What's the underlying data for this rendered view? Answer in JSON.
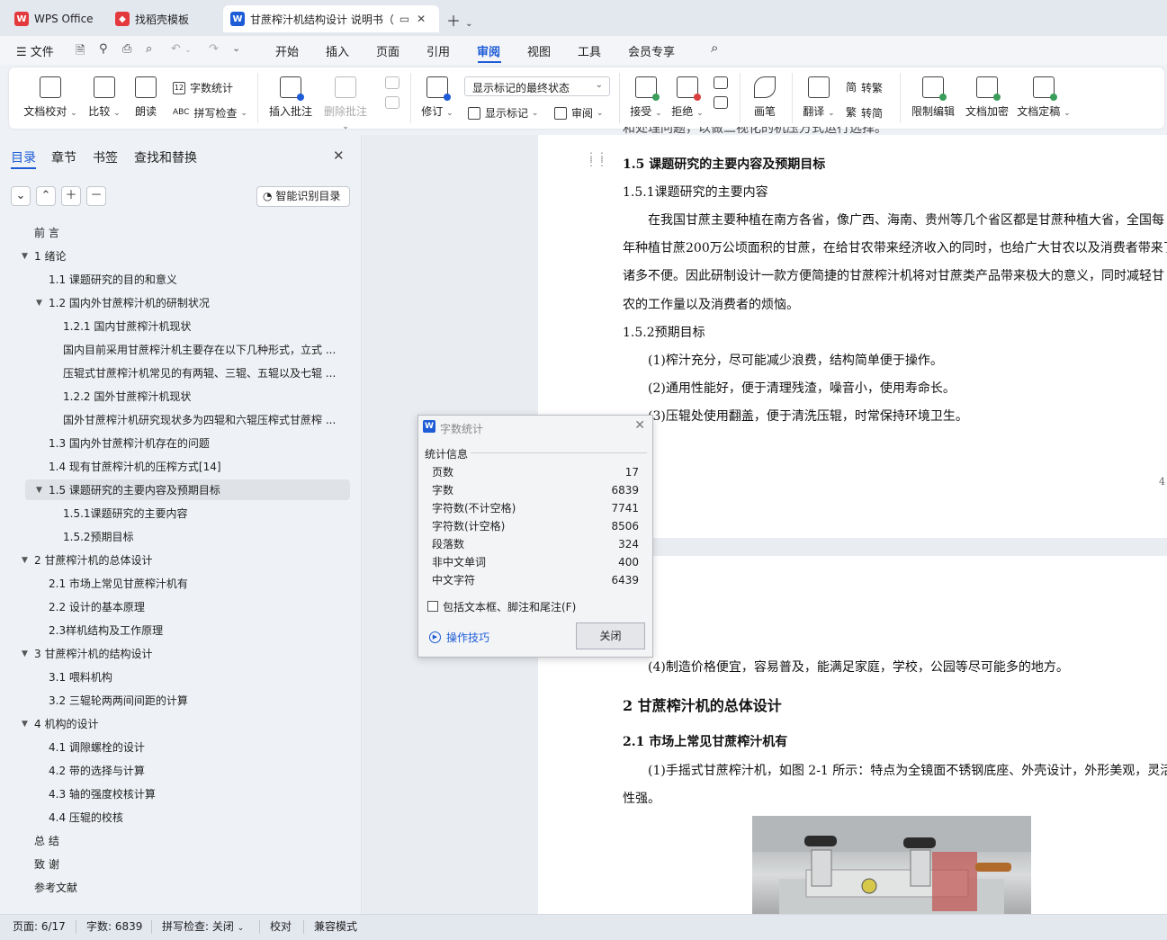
{
  "tabs": [
    {
      "label": "WPS Office"
    },
    {
      "label": "找稻壳模板"
    },
    {
      "label": "甘蔗榨汁机结构设计 说明书（"
    }
  ],
  "menu": {
    "file": "文件",
    "items": [
      "开始",
      "插入",
      "页面",
      "引用",
      "审阅",
      "视图",
      "工具",
      "会员专享"
    ],
    "active": "审阅"
  },
  "ribbon": {
    "doc_proofread": "文档校对",
    "compare": "比较",
    "read_aloud": "朗读",
    "word_count": "字数统计",
    "spell_check": "拼写检查",
    "insert_comment": "插入批注",
    "delete_comment": "删除批注",
    "revise": "修订",
    "mark_state": "显示标记的最终状态",
    "show_marks": "显示标记",
    "review": "审阅",
    "accept": "接受",
    "reject": "拒绝",
    "pen": "画笔",
    "translate": "翻译",
    "to_traditional": "转繁",
    "to_simplified": "转简",
    "restrict_edit": "限制编辑",
    "encrypt": "文档加密",
    "finalize": "文档定稿"
  },
  "nav": {
    "tabs": [
      "目录",
      "章节",
      "书签",
      "查找和替换"
    ],
    "smart_toc": "智能识别目录",
    "toc": [
      {
        "label": "前 言"
      },
      {
        "label": "1 绪论"
      },
      {
        "label": "1.1 课题研究的目的和意义"
      },
      {
        "label": "1.2 国内外甘蔗榨汁机的研制状况"
      },
      {
        "label": "1.2.1 国内甘蔗榨汁机现状"
      },
      {
        "label": "国内目前采用甘蔗榨汁机主要存在以下几种形式，立式 ..."
      },
      {
        "label": "压辊式甘蔗榨汁机常见的有两辊、三辊、五辊以及七辊 ..."
      },
      {
        "label": "1.2.2  国外甘蔗榨汁机现状"
      },
      {
        "label": "国外甘蔗榨汁机研究现状多为四辊和六辊压榨式甘蔗榨 ..."
      },
      {
        "label": "1.3 国内外甘蔗榨汁机存在的问题"
      },
      {
        "label": "1.4 现有甘蔗榨汁机的压榨方式[14]"
      },
      {
        "label": "1.5 课题研究的主要内容及预期目标"
      },
      {
        "label": "1.5.1课题研究的主要内容"
      },
      {
        "label": "1.5.2预期目标"
      },
      {
        "label": "2 甘蔗榨汁机的总体设计"
      },
      {
        "label": "2.1 市场上常见甘蔗榨汁机有"
      },
      {
        "label": "2.2 设计的基本原理"
      },
      {
        "label": "2.3样机结构及工作原理"
      },
      {
        "label": "3 甘蔗榨汁机的结构设计"
      },
      {
        "label": "3.1 喂料机构"
      },
      {
        "label": "3.2 三辊轮两两间间距的计算"
      },
      {
        "label": "4 机构的设计"
      },
      {
        "label": "4.1 调隙螺栓的设计"
      },
      {
        "label": "4.2 带的选择与计算"
      },
      {
        "label": "4.3 轴的强度校核计算"
      },
      {
        "label": "4.4 压辊的校核"
      },
      {
        "label": "总 结"
      },
      {
        "label": "致 谢"
      },
      {
        "label": "参考文献"
      }
    ]
  },
  "doc": {
    "top_fragment": "和处理问题，以做二视化的机压方式运行选择。",
    "h_1_5": "1.5 课题研究的主要内容及预期目标",
    "h_1_5_1": "1.5.1课题研究的主要内容",
    "p1_l1": "在我国甘蔗主要种植在南方各省，像广西、海南、贵州等几个省区都是甘蔗种植大省，全国每",
    "p1_l2": "年种植甘蔗200万公顷面积的甘蔗，在给甘农带来经济收入的同时，也给广大甘农以及消费者带来了",
    "p1_l3": "诸多不便。因此研制设计一款方便简捷的甘蔗榨汁机将对甘蔗类产品带来极大的意义，同时减轻甘",
    "p1_l4": "农的工作量以及消费者的烦恼。",
    "h_1_5_2": "1.5.2预期目标",
    "goal1": "(1)榨汁充分，尽可能减少浪费，结构简单便于操作。",
    "goal2": "(2)通用性能好，便于清理残渣，噪音小，使用寿命长。",
    "goal3": "(3)压辊处使用翻盖，便于清洗压辊，时常保持环境卫生。",
    "page_num": "4",
    "goal4": "(4)制造价格便宜，容易普及，能满足家庭，学校，公园等尽可能多的地方。",
    "h_2": "2 甘蔗榨汁机的总体设计",
    "h_2_1": "2.1 市场上常见甘蔗榨汁机有",
    "p2_l1": "(1)手摇式甘蔗榨汁机，如图 2-1 所示：特点为全镜面不锈钢底座、外壳设计，外形美观，灵活",
    "p2_l2": "性强。"
  },
  "dialog": {
    "title": "字数统计",
    "group": "统计信息",
    "stats": [
      {
        "label": "页数",
        "value": "17"
      },
      {
        "label": "字数",
        "value": "6839"
      },
      {
        "label": "字符数(不计空格)",
        "value": "7741"
      },
      {
        "label": "字符数(计空格)",
        "value": "8506"
      },
      {
        "label": "段落数",
        "value": "324"
      },
      {
        "label": "非中文单词",
        "value": "400"
      },
      {
        "label": "中文字符",
        "value": "6439"
      }
    ],
    "checkbox": "包括文本框、脚注和尾注(F)",
    "tips": "操作技巧",
    "close": "关闭"
  },
  "status": {
    "page": "页面: 6/17",
    "words": "字数: 6839",
    "spell": "拼写检查: 关闭",
    "proof": "校对",
    "compat": "兼容模式"
  },
  "colors": {
    "accent": "#1d5cd6",
    "wps_red": "#e4393c"
  }
}
